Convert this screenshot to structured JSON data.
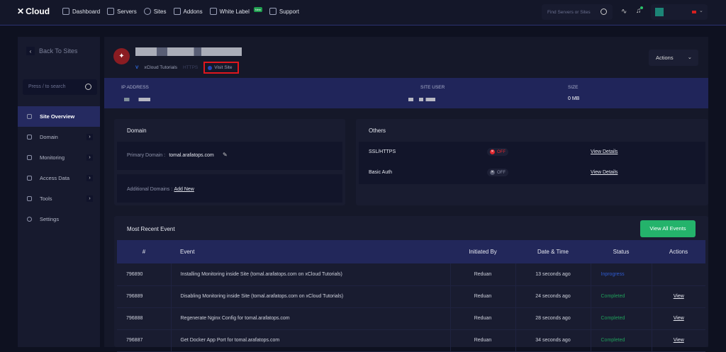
{
  "nav": {
    "logo": "Cloud",
    "items": [
      {
        "label": "Dashboard",
        "icon": "dashboard-icon"
      },
      {
        "label": "Servers",
        "icon": "servers-icon"
      },
      {
        "label": "Sites",
        "icon": "globe-icon"
      },
      {
        "label": "Addons",
        "icon": "puzzle-icon"
      },
      {
        "label": "White Label",
        "icon": "white-label-icon",
        "badge": "New"
      },
      {
        "label": "Support",
        "icon": "support-icon"
      }
    ],
    "search_placeholder": "Find Servers or Sites"
  },
  "sidebar": {
    "back": "Back To Sites",
    "search_placeholder": "Press / to search",
    "items": [
      {
        "label": "Site Overview",
        "active": true
      },
      {
        "label": "Domain",
        "arrow": true
      },
      {
        "label": "Monitoring",
        "arrow": true
      },
      {
        "label": "Access Data",
        "arrow": true
      },
      {
        "label": "Tools",
        "arrow": true
      },
      {
        "label": "Settings"
      }
    ]
  },
  "site": {
    "server": "xCloud Tutorials",
    "https": "HTTPS",
    "visit": "Visit Site",
    "actions": "Actions"
  },
  "info": {
    "ip_label": "IP ADDRESS",
    "user_label": "SITE USER",
    "size_label": "SIZE",
    "size": "0 MB"
  },
  "domain": {
    "title": "Domain",
    "primary_label": "Primary Domain :",
    "primary": "tomal.arafatops.com",
    "additional_label": "Additional Domains :",
    "add_new": "Add New"
  },
  "others": {
    "title": "Others",
    "rows": [
      {
        "label": "SSL/HTTPS",
        "status": "OFF",
        "link": "View Details"
      },
      {
        "label": "Basic Auth",
        "status": "OFF",
        "link": "View Details"
      }
    ]
  },
  "events": {
    "title": "Most Recent Event",
    "view_all": "View All Events",
    "columns": [
      "#",
      "Event",
      "Initiated By",
      "Date & Time",
      "Status",
      "Actions"
    ],
    "rows": [
      {
        "id": "796890",
        "event": "Installing Monitoring inside Site (tomal.arafatops.com on xCloud Tutorials)",
        "by": "Reduan",
        "time": "13 seconds ago",
        "status": "Inprogress",
        "action": ""
      },
      {
        "id": "796889",
        "event": "Disabling Monitoring inside Site (tomal.arafatops.com on xCloud Tutorials)",
        "by": "Reduan",
        "time": "24 seconds ago",
        "status": "Completed",
        "action": "View"
      },
      {
        "id": "796888",
        "event": "Regenerate Nginx Config for tomal.arafatops.com",
        "by": "Reduan",
        "time": "28 seconds ago",
        "status": "Completed",
        "action": "View"
      },
      {
        "id": "796887",
        "event": "Get Docker App Port for tomal.arafatops.com",
        "by": "Reduan",
        "time": "34 seconds ago",
        "status": "Completed",
        "action": "View"
      }
    ]
  },
  "colors": {
    "inprogress": "#2f5bd0",
    "completed": "#1f9e5a",
    "ssl_off": "#e0262d",
    "accent": "#24b36b"
  }
}
